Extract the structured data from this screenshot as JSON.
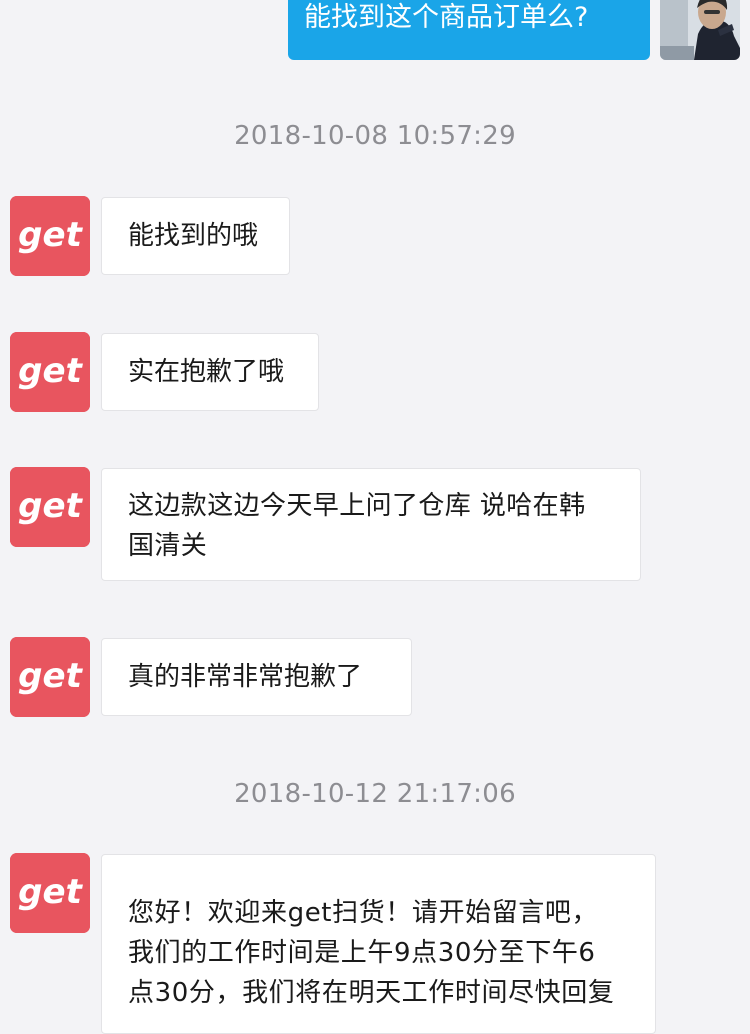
{
  "conversation": {
    "outgoing": {
      "text": "能找到这个商品订单么?",
      "avatar_icon": "user-photo-avatar"
    },
    "timestamps": [
      "2018-10-08 10:57:29",
      "2018-10-12 21:17:06"
    ],
    "agent": {
      "avatar_label": "get",
      "avatar_color": "#e8555f",
      "avatar_icon": "get-logo-avatar"
    },
    "incoming": [
      {
        "text": "能找到的哦"
      },
      {
        "text": "实在抱歉了哦"
      },
      {
        "lines": [
          "这边款这边今天早上问了仓库 说哈在韩",
          "国清关"
        ]
      },
      {
        "text": "真的非常非常抱歉了"
      },
      {
        "lines": [
          "您好！欢迎来get扫货！请开始留言吧，",
          "我们的工作时间是上午9点30分至下午6",
          "点30分，我们将在明天工作时间尽快回复"
        ]
      }
    ]
  },
  "colors": {
    "background": "#f3f3f6",
    "outgoing_bubble": "#1aa5e8",
    "incoming_bubble": "#ffffff",
    "timestamp_text": "#8d8d92"
  }
}
